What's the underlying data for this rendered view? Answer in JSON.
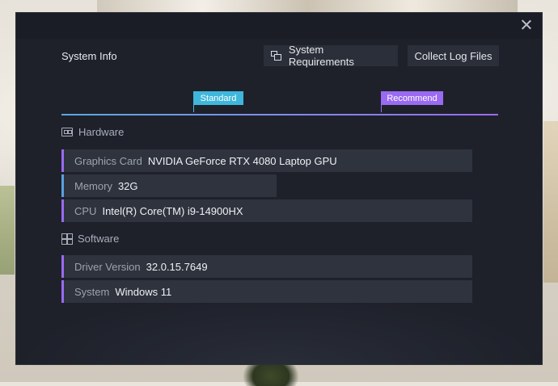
{
  "dialog": {
    "title": "System Info",
    "buttons": {
      "system_requirements": "System Requirements",
      "collect_log_files": "Collect Log Files"
    }
  },
  "legend": {
    "standard": "Standard",
    "recommend": "Recommend",
    "colors": {
      "standard": "#3fb7dc",
      "recommend": "#9a6af2"
    }
  },
  "hardware": {
    "heading": "Hardware",
    "rows": [
      {
        "label": "Graphics Card",
        "value": "NVIDIA GeForce RTX 4080 Laptop GPU"
      },
      {
        "label": "Memory",
        "value": "32G"
      },
      {
        "label": "CPU",
        "value": "Intel(R) Core(TM) i9-14900HX"
      }
    ]
  },
  "software": {
    "heading": "Software",
    "rows": [
      {
        "label": "Driver Version",
        "value": "32.0.15.7649"
      },
      {
        "label": "System",
        "value": "Windows 11"
      }
    ]
  },
  "icons": {
    "close": "close-icon",
    "requirements": "copy-icon",
    "hardware": "chip-icon",
    "software": "windows-icon"
  }
}
